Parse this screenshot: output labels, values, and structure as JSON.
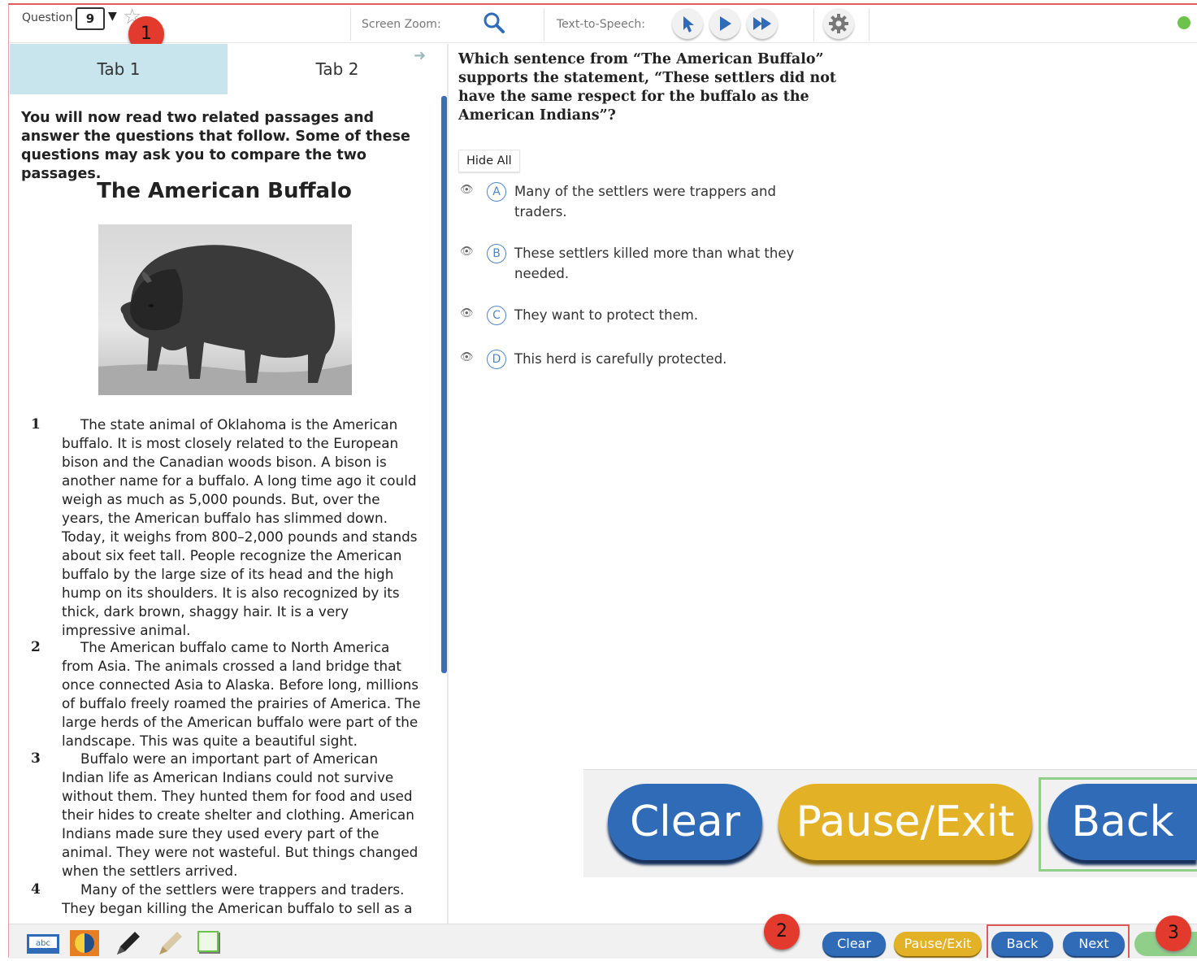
{
  "topbar": {
    "question_label": "Question",
    "question_number": "9",
    "dropdown_arrow": "▼",
    "screen_zoom_label": "Screen Zoom:",
    "tts_label": "Text-to-Speech:",
    "icons": [
      "star-icon",
      "search-icon",
      "tts-pointer-icon",
      "play-icon",
      "fast-forward-icon",
      "gear-icon",
      "status-dot-icon"
    ],
    "status_color": "#6cc24a"
  },
  "callouts": [
    "1",
    "2",
    "3"
  ],
  "tabs": [
    {
      "label": "Tab 1",
      "active": true
    },
    {
      "label": "Tab 2",
      "active": false
    }
  ],
  "passage": {
    "intro": "You will now read two related passages and answer the questions that follow. Some of these questions may ask you to compare the two passages.",
    "title": "The American Buffalo",
    "paragraphs": [
      {
        "num": "1",
        "lines": [
          "The state animal of Oklahoma is the American",
          "buffalo. It is most closely related to the European",
          "bison and the Canadian woods bison. A bison is",
          "another name for a buffalo. A long time ago it could",
          "weigh as much as 5,000 pounds. But, over the",
          "years, the American buffalo has slimmed down.",
          "Today, it weighs from 800–2,000 pounds and stands",
          "about six feet tall. People recognize the American",
          "buffalo by the large size of its head and the high",
          "hump on its shoulders. It is also recognized by its",
          "thick, dark brown, shaggy hair. It is a very",
          "impressive animal."
        ]
      },
      {
        "num": "2",
        "lines": [
          "The American buffalo came to North America",
          "from Asia. The animals crossed a land bridge that",
          "once connected Asia to Alaska. Before long, millions",
          "of buffalo freely roamed the prairies of America. The",
          "large herds of the American buffalo were part of the",
          "landscape. This was quite a beautiful sight."
        ]
      },
      {
        "num": "3",
        "lines": [
          "Buffalo were an important part of American",
          "Indian life as American Indians could not survive",
          "without them. They hunted them for food and used",
          "their hides to create shelter and clothing. American",
          "Indians made sure they used every part of the",
          "animal. They were not wasteful. But things changed",
          "when the settlers arrived."
        ]
      },
      {
        "num": "4",
        "lines": [
          "Many of the settlers were trappers and traders.",
          "They began killing the American buffalo to sell as a"
        ]
      }
    ]
  },
  "question": {
    "text": "Which sentence from “The American Buffalo” supports the statement, “These settlers did not have the same respect for the buffalo as the American Indians”?",
    "hide_all": "Hide All",
    "options": [
      {
        "letter": "A",
        "lines": [
          "Many of the settlers were trappers and",
          "traders."
        ]
      },
      {
        "letter": "B",
        "lines": [
          "These settlers killed more than what they",
          "needed."
        ]
      },
      {
        "letter": "C",
        "lines": [
          "They want to protect them."
        ]
      },
      {
        "letter": "D",
        "lines": [
          "This herd is carefully protected."
        ]
      }
    ]
  },
  "zoom_buttons": {
    "clear": "Clear",
    "pause": "Pause/Exit",
    "back": "Back"
  },
  "bottom_buttons": {
    "clear": "Clear",
    "pause": "Pause/Exit",
    "back": "Back",
    "next": "Next"
  },
  "tools": [
    "abc-tool-icon",
    "color-contrast-icon",
    "pencil-icon",
    "highlighter-icon",
    "notepad-icon"
  ],
  "colors": {
    "blue": "#2f6bb7",
    "yellow": "#e3b125",
    "tab_active": "#c8e4ec",
    "callout": "#e23b2e"
  }
}
